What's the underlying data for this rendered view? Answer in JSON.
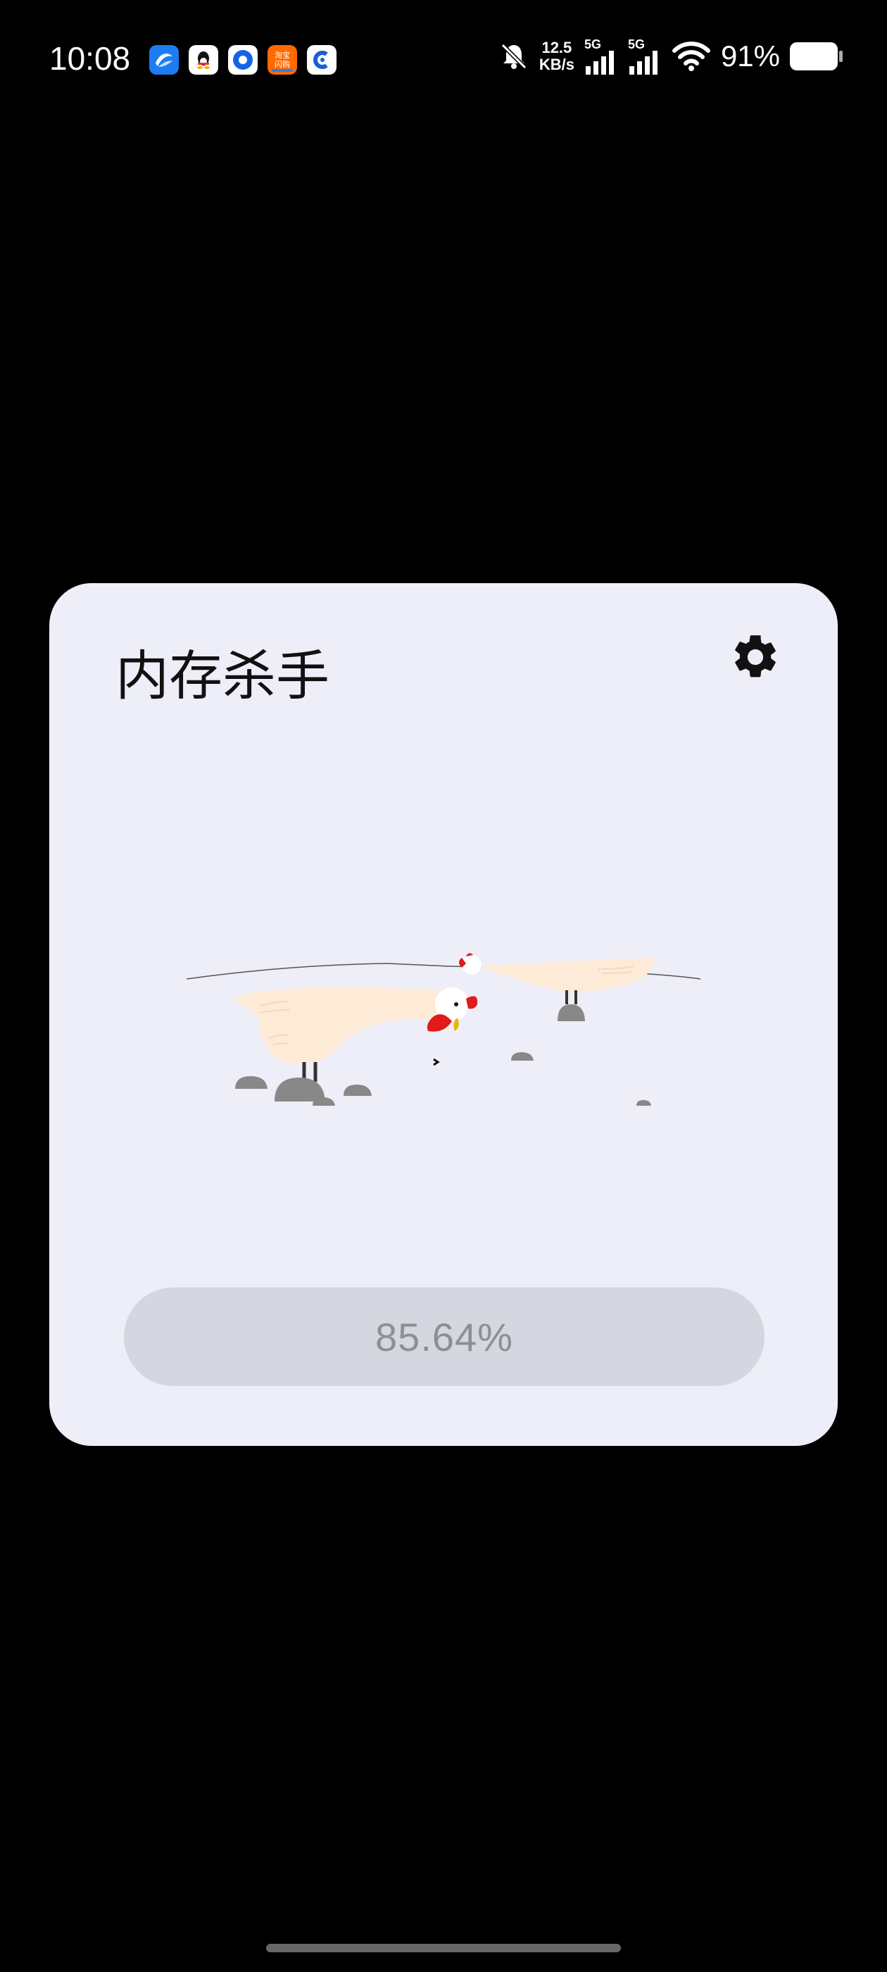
{
  "status_bar": {
    "time": "10:08",
    "apps": [
      "blue-swirl-app-icon",
      "qq-app-icon",
      "blue-circle-app-icon",
      "taobao-flash-app-icon",
      "blue-c-app-icon"
    ],
    "taobao_flash_text": "淘宝\n闪购",
    "net_speed_value": "12.5",
    "net_speed_unit": "KB/s",
    "signal_1_label": "5G",
    "signal_2_label": "5G",
    "battery_percent": "91%",
    "battery_level": 0.91
  },
  "card": {
    "title": "内存杀手",
    "settings_icon": "gear-icon",
    "scene": "chickens-on-rocks-illustration",
    "progress_text": "85.64%",
    "colors": {
      "card_bg": "#eeeef8",
      "progress_bg": "#d6d6e0",
      "progress_text": "#8e8e96"
    }
  }
}
